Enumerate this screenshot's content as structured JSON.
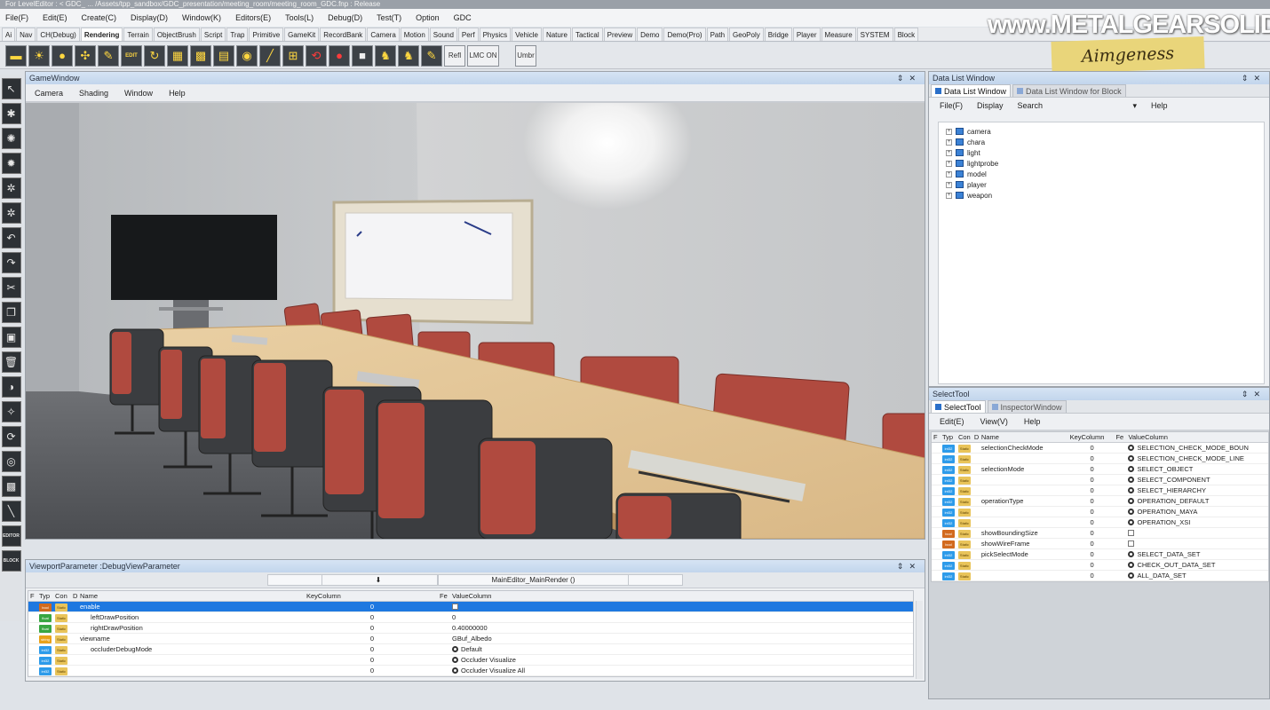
{
  "window": {
    "title": "For LevelEditor : < GDC_ ... /Assets/tpp_sandbox/GDC_presentation/meeting_room/meeting_room_GDC.fnp : Release"
  },
  "menubar": [
    "File(F)",
    "Edit(E)",
    "Create(C)",
    "Display(D)",
    "Window(K)",
    "Editors(E)",
    "Tools(L)",
    "Debug(D)",
    "Test(T)",
    "Option",
    "GDC"
  ],
  "category_tabs": [
    "Ai",
    "Nav",
    "CH(Debug)",
    "Rendering",
    "Terrain",
    "ObjectBrush",
    "Script",
    "Trap",
    "Primitive",
    "GameKit",
    "RecordBank",
    "Camera",
    "Motion",
    "Sound",
    "Perf",
    "Physics",
    "Vehicle",
    "Nature",
    "Tactical",
    "Preview",
    "Demo",
    "Demo(Pro)",
    "Path",
    "GeoPoly",
    "Bridge",
    "Player",
    "Measure",
    "SYSTEM",
    "Block"
  ],
  "active_category": "Rendering",
  "toolbar": {
    "edit_label": "EDIT",
    "refl_label": "Refl",
    "lmc_label": "LMC ON",
    "umb_label": "Umbr"
  },
  "watermark": {
    "site": "www.METALGEARSOLID.BE",
    "badge": "Aimgeness"
  },
  "left_tools": {
    "editor_label": "EDITOR",
    "block_label": "BLOCK"
  },
  "game_window": {
    "title": "GameWindow",
    "menu": [
      "Camera",
      "Shading",
      "Window",
      "Help"
    ]
  },
  "data_list": {
    "title": "Data List Window",
    "tabs": [
      "Data List Window",
      "Data List Window for Block"
    ],
    "menu": [
      "File(F)",
      "Display",
      "Search",
      "Help"
    ],
    "tree": [
      "camera",
      "chara",
      "light",
      "lightprobe",
      "model",
      "player",
      "weapon"
    ]
  },
  "select_tool": {
    "title": "SelectTool",
    "tabs": [
      "SelectTool",
      "InspectorWindow"
    ],
    "menu": [
      "Edit(E)",
      "View(V)",
      "Help"
    ],
    "columns": [
      "F",
      "Typ",
      "Con",
      "D",
      "Name",
      "KeyColumn",
      "Fe",
      "ValueColumn"
    ],
    "rows": [
      {
        "type": "int32",
        "con": "Static",
        "name": "selectionCheckMode",
        "key": "0",
        "kind": "radio",
        "value": "SELECTION_CHECK_MODE_BOUN"
      },
      {
        "type": "int32",
        "con": "Static",
        "name": "",
        "key": "0",
        "kind": "radio",
        "value": "SELECTION_CHECK_MODE_LINE"
      },
      {
        "type": "int32",
        "con": "Static",
        "name": "selectionMode",
        "key": "0",
        "kind": "radio",
        "value": "SELECT_OBJECT"
      },
      {
        "type": "int32",
        "con": "Static",
        "name": "",
        "key": "0",
        "kind": "radio",
        "value": "SELECT_COMPONENT"
      },
      {
        "type": "int32",
        "con": "Static",
        "name": "",
        "key": "0",
        "kind": "radio",
        "value": "SELECT_HIERARCHY"
      },
      {
        "type": "int32",
        "con": "Static",
        "name": "operationType",
        "key": "0",
        "kind": "radio",
        "value": "OPERATION_DEFAULT"
      },
      {
        "type": "int32",
        "con": "Static",
        "name": "",
        "key": "0",
        "kind": "radio",
        "value": "OPERATION_MAYA"
      },
      {
        "type": "int32",
        "con": "Static",
        "name": "",
        "key": "0",
        "kind": "radio",
        "value": "OPERATION_XSI"
      },
      {
        "type": "bool",
        "con": "Static",
        "name": "showBoundingSize",
        "key": "0",
        "kind": "check",
        "value": ""
      },
      {
        "type": "bool",
        "con": "Static",
        "name": "showWireFrame",
        "key": "0",
        "kind": "check",
        "value": ""
      },
      {
        "type": "int32",
        "con": "Static",
        "name": "pickSelectMode",
        "key": "0",
        "kind": "radio",
        "value": "SELECT_DATA_SET"
      },
      {
        "type": "int32",
        "con": "Static",
        "name": "",
        "key": "0",
        "kind": "radio",
        "value": "CHECK_OUT_DATA_SET"
      },
      {
        "type": "int32",
        "con": "Static",
        "name": "",
        "key": "0",
        "kind": "radio",
        "value": "ALL_DATA_SET"
      }
    ]
  },
  "viewport_param": {
    "title": "ViewportParameter :DebugViewParameter",
    "subheader": "MainEditor_MainRender ()",
    "columns": [
      "F",
      "Typ",
      "Con",
      "D",
      "Name",
      "KeyColumn",
      "Fe",
      "ValueColumn"
    ],
    "rows": [
      {
        "type": "bool",
        "con": "Static",
        "name": "enable",
        "indent": false,
        "key": "0",
        "kind": "check",
        "value": "",
        "selected": true
      },
      {
        "type": "float",
        "con": "Static",
        "name": "leftDrawPosition",
        "indent": true,
        "key": "0",
        "kind": "text",
        "value": "0",
        "selected": false
      },
      {
        "type": "float",
        "con": "Static",
        "name": "rightDrawPosition",
        "indent": true,
        "key": "0",
        "kind": "text",
        "value": "0.40000000",
        "selected": false
      },
      {
        "type": "string",
        "con": "Static",
        "name": "viewname",
        "indent": false,
        "key": "0",
        "kind": "text",
        "value": "GBuf_Albedo",
        "selected": false
      },
      {
        "type": "int32",
        "con": "Static",
        "name": "occluderDebugMode",
        "indent": true,
        "key": "0",
        "kind": "radio",
        "value": "Default",
        "selected": false
      },
      {
        "type": "int32",
        "con": "Static",
        "name": "",
        "indent": true,
        "key": "0",
        "kind": "radio",
        "value": "Occluder Visualize",
        "selected": false
      },
      {
        "type": "int32",
        "con": "Static",
        "name": "",
        "indent": true,
        "key": "0",
        "kind": "radio",
        "value": "Occluder Visualize All",
        "selected": false
      }
    ]
  }
}
